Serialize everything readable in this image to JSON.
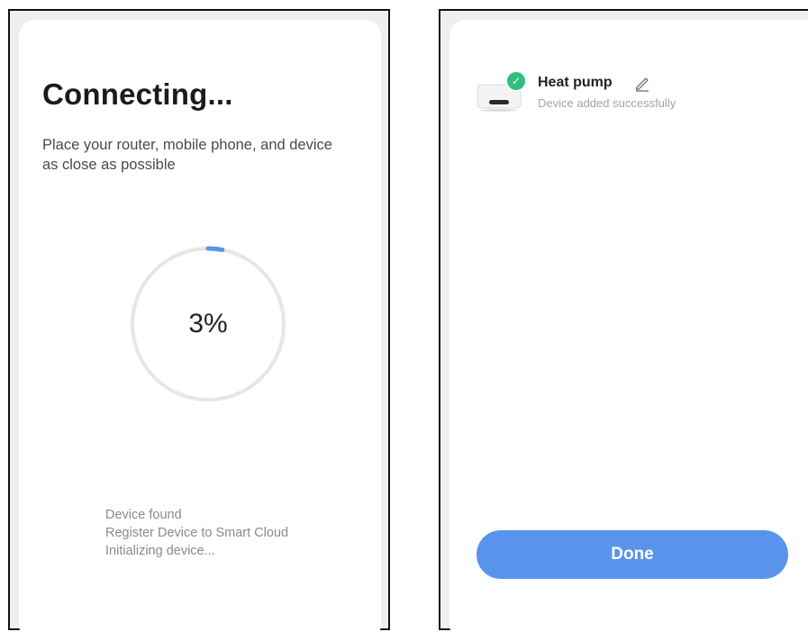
{
  "connecting_screen": {
    "title": "Connecting...",
    "subtitle": "Place your router, mobile phone, and device as close as possible",
    "progress": {
      "value": 3,
      "label": "3%"
    },
    "steps": [
      "Device found",
      "Register Device to Smart Cloud",
      "Initializing device..."
    ]
  },
  "success_screen": {
    "device_name": "Heat pump",
    "device_status": "Device added successfully",
    "done_label": "Done"
  },
  "icons": {
    "status": "check-icon",
    "edit": "pencil-icon",
    "device": "heat-pump-thumbnail-icon"
  },
  "colors": {
    "accent": "#5a93ec",
    "success": "#2fbf7a",
    "ring_track": "#e6e6e6"
  }
}
